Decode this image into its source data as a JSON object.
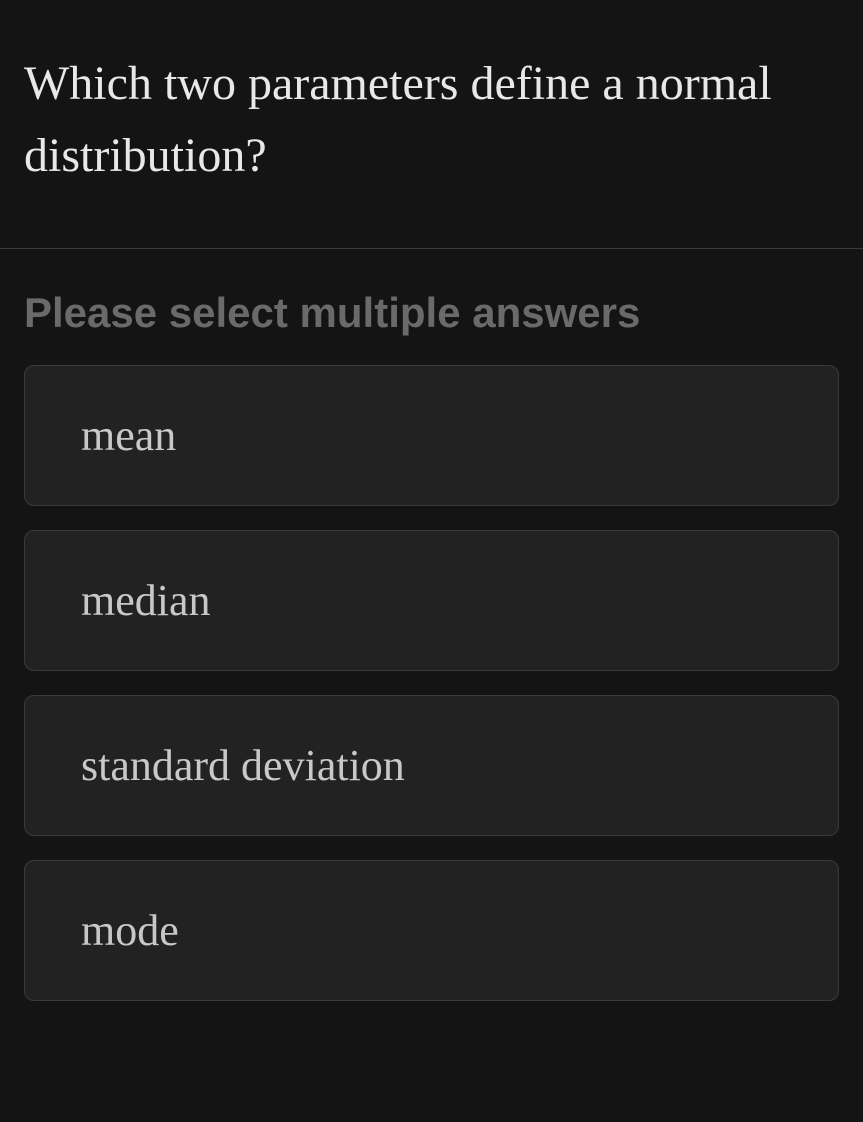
{
  "question": {
    "text": "Which two parameters define a normal distribution?"
  },
  "instruction": "Please select multiple answers",
  "options": [
    {
      "label": "mean"
    },
    {
      "label": "median"
    },
    {
      "label": "standard deviation"
    },
    {
      "label": "mode"
    }
  ]
}
